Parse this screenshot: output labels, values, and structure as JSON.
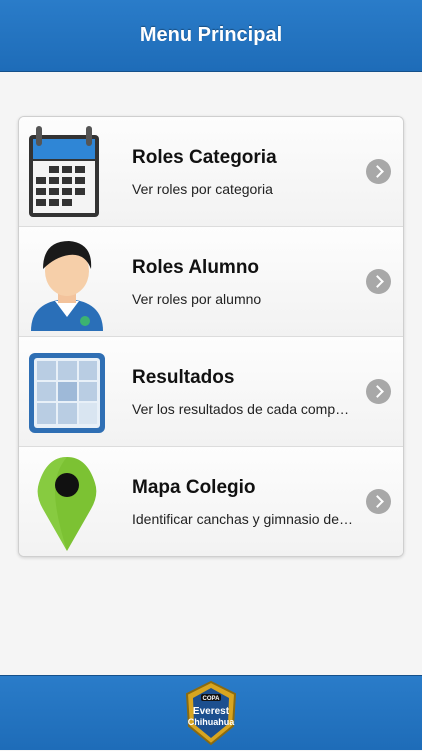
{
  "header": {
    "title": "Menu Principal"
  },
  "menu": {
    "items": [
      {
        "title": "Roles Categoria",
        "subtitle": "Ver roles por categoria",
        "icon": "calendar-icon"
      },
      {
        "title": "Roles Alumno",
        "subtitle": "Ver roles por alumno",
        "icon": "student-avatar-icon"
      },
      {
        "title": "Resultados",
        "subtitle": "Ver los resultados de cada competencia",
        "icon": "grid-table-icon"
      },
      {
        "title": "Mapa Colegio",
        "subtitle": "Identificar canchas y gimnasio del colegio",
        "icon": "map-pin-icon"
      }
    ]
  },
  "footer": {
    "logo": {
      "top_text": "COPA",
      "line1": "Everest",
      "line2": "Chihuahua"
    }
  },
  "colors": {
    "header_blue": "#1e6cb8",
    "chevron_gray": "#a8a8a8",
    "pin_green": "#7cc233"
  }
}
